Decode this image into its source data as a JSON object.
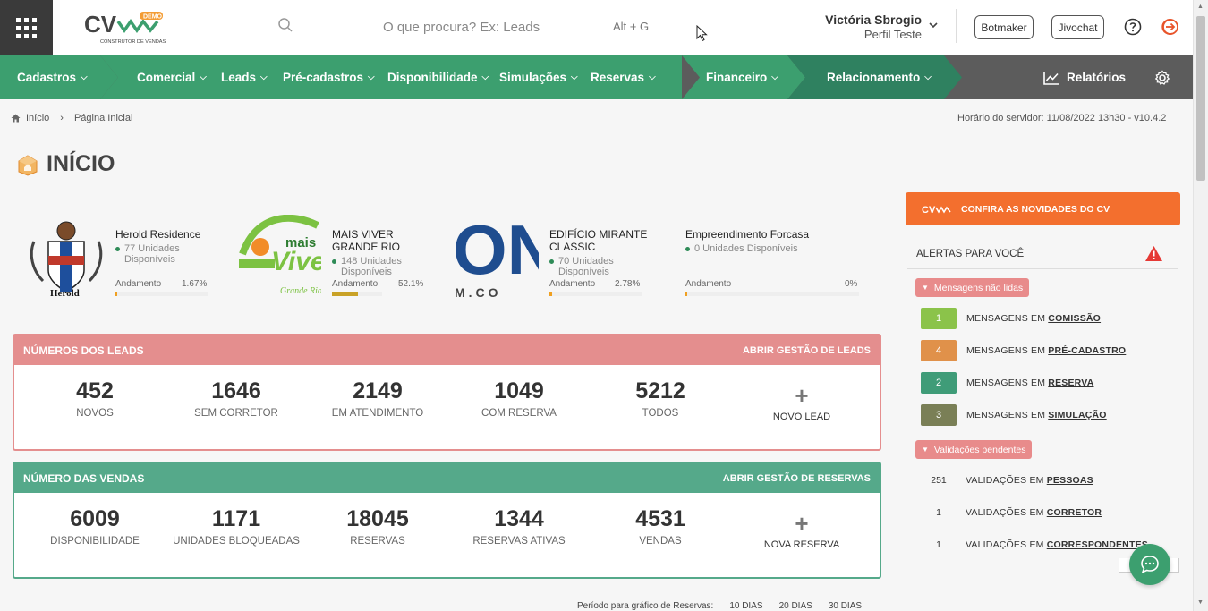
{
  "header": {
    "search_placeholder": "O que procura? Ex: Leads",
    "search_shortcut": "Alt + G",
    "user_name": "Victória Sbrogio",
    "user_profile": "Perfil Teste",
    "btn_botmaker": "Botmaker",
    "btn_jivochat": "Jivochat",
    "logo_text": "CV",
    "logo_tag": "DEMO",
    "logo_sub": "CONSTRUTOR DE VENDAS"
  },
  "nav": {
    "items": [
      {
        "label": "Cadastros"
      },
      {
        "label": "Comercial"
      },
      {
        "label": "Leads"
      },
      {
        "label": "Pré-cadastros"
      },
      {
        "label": "Disponibilidade"
      },
      {
        "label": "Simulações"
      },
      {
        "label": "Reservas"
      },
      {
        "label": "Financeiro"
      },
      {
        "label": "Relacionamento"
      }
    ],
    "reports": "Relatórios",
    "colors": {
      "light": "#3c9f6f",
      "dark": "#2f8160",
      "gray": "#5c5c5c"
    }
  },
  "breadcrumb": {
    "home": "Início",
    "current": "Página Inicial"
  },
  "server_time": "Horário do servidor: 11/08/2022 13h30 - v10.4.2",
  "page_title": "INÍCIO",
  "empreendimentos": [
    {
      "name": "Herold Residence",
      "units": "77 Unidades Disponíveis",
      "progress_label": "Andamento",
      "progress": "1.67%",
      "logo_text": "Herold"
    },
    {
      "name": "MAIS VIVER GRANDE RIO",
      "units": "148 Unidades Disponíveis",
      "progress_label": "Andamento",
      "progress": "52.1%",
      "logo_text": "mais Viver"
    },
    {
      "name": "EDIFÍCIO MIRANTE CLASSIC",
      "units": "70 Unidades Disponíveis",
      "progress_label": "Andamento",
      "progress": "2.78%",
      "logo_text": "ON",
      "logo_sub": "M.CO"
    },
    {
      "name": "Empreendimento Forcasa",
      "units": "0 Unidades Disponíveis",
      "progress_label": "Andamento",
      "progress": "0%"
    }
  ],
  "leads": {
    "title": "NÚMEROS DOS LEADS",
    "link": "ABRIR GESTÃO DE LEADS",
    "stats": [
      {
        "value": "452",
        "label": "NOVOS"
      },
      {
        "value": "1646",
        "label": "SEM CORRETOR"
      },
      {
        "value": "2149",
        "label": "EM ATENDIMENTO"
      },
      {
        "value": "1049",
        "label": "COM RESERVA"
      },
      {
        "value": "5212",
        "label": "TODOS"
      }
    ],
    "add_label": "NOVO LEAD",
    "color": "#e48e8e"
  },
  "vendas": {
    "title": "NÚMERO DAS VENDAS",
    "link": "ABRIR GESTÃO DE RESERVAS",
    "stats": [
      {
        "value": "6009",
        "label": "DISPONIBILIDADE"
      },
      {
        "value": "1171",
        "label": "UNIDADES BLOQUEADAS"
      },
      {
        "value": "18045",
        "label": "RESERVAS"
      },
      {
        "value": "1344",
        "label": "RESERVAS ATIVAS"
      },
      {
        "value": "4531",
        "label": "VENDAS"
      }
    ],
    "add_label": "NOVA RESERVA",
    "color": "#55a98a"
  },
  "period": {
    "label": "Período para gráfico de Reservas:",
    "options": [
      "10 DIAS",
      "20 DIAS",
      "30 DIAS"
    ]
  },
  "sidebar": {
    "novidades": "CONFIRA AS NOVIDADES DO CV",
    "alerts_title": "ALERTAS PARA VOCÊ",
    "unread_label": "Mensagens não lidas",
    "messages": [
      {
        "count": "1",
        "prefix": "MENSAGENS EM ",
        "target": "COMISSÃO",
        "color": "#8bc34a"
      },
      {
        "count": "4",
        "prefix": "MENSAGENS EM ",
        "target": "PRÉ-CADASTRO",
        "color": "#e0914a"
      },
      {
        "count": "2",
        "prefix": "MENSAGENS EM ",
        "target": "RESERVA",
        "color": "#3f9c78"
      },
      {
        "count": "3",
        "prefix": "MENSAGENS EM ",
        "target": "SIMULAÇÃO",
        "color": "#7a7f56"
      }
    ],
    "pending_label": "Validações pendentes",
    "validations": [
      {
        "count": "251",
        "prefix": "VALIDAÇÕES EM ",
        "target": "PESSOAS"
      },
      {
        "count": "1",
        "prefix": "VALIDAÇÕES EM ",
        "target": "CORRETOR"
      },
      {
        "count": "1",
        "prefix": "VALIDAÇÕES EM ",
        "target": "CORRESPONDENTES"
      }
    ]
  }
}
